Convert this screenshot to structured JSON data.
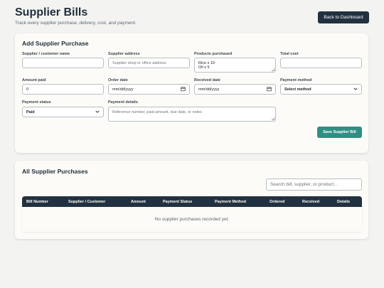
{
  "header": {
    "title": "Supplier Bills",
    "subtitle": "Track every supplier purchase, delivery, cost, and payment.",
    "back_label": "Back to Dashboard"
  },
  "form": {
    "title": "Add Supplier Purchase",
    "supplier_name": {
      "label": "Supplier / customer name",
      "value": ""
    },
    "supplier_address": {
      "label": "Supplier address",
      "placeholder": "Supplier shop or office address"
    },
    "products": {
      "label": "Products purchased",
      "value": "Rice x 10\nOil x 5"
    },
    "total_cost": {
      "label": "Total cost",
      "value": ""
    },
    "amount_paid": {
      "label": "Amount paid",
      "value": "0"
    },
    "order_date": {
      "label": "Order date",
      "value": "mm/dd/yyyy"
    },
    "received_date": {
      "label": "Received date",
      "value": "mm/dd/yyyy"
    },
    "payment_method": {
      "label": "Payment method",
      "value": "Select method"
    },
    "payment_status": {
      "label": "Payment status",
      "value": "Paid"
    },
    "payment_details": {
      "label": "Payment details",
      "placeholder": "Reference number, paid amount, due date, or notes"
    },
    "save_label": "Save Supplier Bill"
  },
  "list": {
    "title": "All Supplier Purchases",
    "search_placeholder": "Search bill, supplier, or product...",
    "columns": [
      "Bill Number",
      "Supplier / Customer",
      "Amount",
      "Payment Status",
      "Payment Method",
      "Ordered",
      "Received",
      "Details"
    ],
    "empty_message": "No supplier purchases recorded yet."
  },
  "icons": {
    "calendar": "calendar-icon",
    "chevron": "chevron-down-icon"
  },
  "colors": {
    "primary_dark": "#22313f",
    "accent": "#2f8f83",
    "background": "#f3f4f1",
    "card": "#fcfbf7"
  }
}
